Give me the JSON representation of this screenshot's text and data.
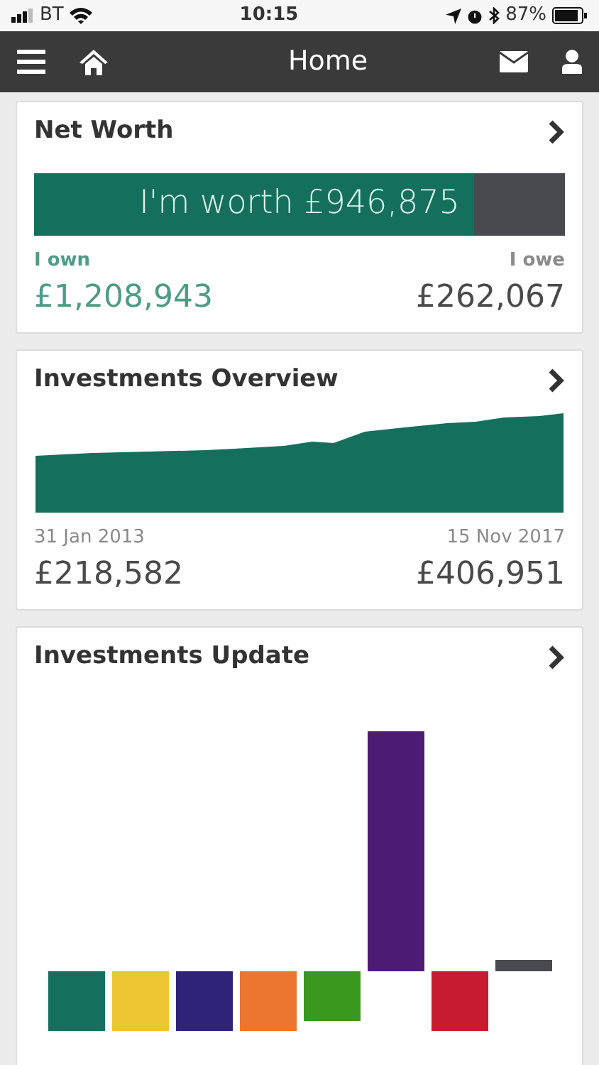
{
  "status_bar": {
    "carrier": "BT",
    "time": "10:15",
    "battery": "87%"
  },
  "nav": {
    "title": "Home"
  },
  "net_worth": {
    "title": "Net Worth",
    "banner": "I'm worth £946,875",
    "level": 0.83,
    "own_label": "I own",
    "own_value": "£1,208,943",
    "owe_label": "I owe",
    "owe_value": "£262,067"
  },
  "investments_overview": {
    "title": "Investments Overview",
    "start_date": "31 Jan 2013",
    "end_date": "15 Nov 2017",
    "start_value": "£218,582",
    "end_value": "£406,951"
  },
  "investments_update": {
    "title": "Investments Update"
  }
}
